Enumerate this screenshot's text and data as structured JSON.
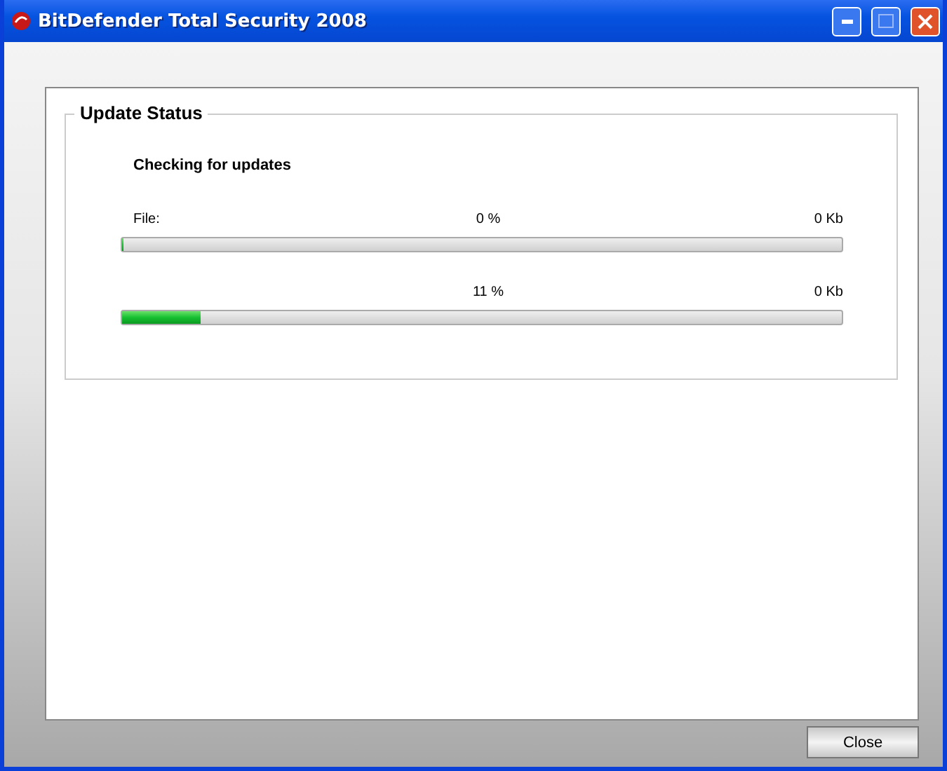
{
  "window": {
    "title": "BitDefender Total Security 2008"
  },
  "update_status": {
    "title": "Update Status",
    "message": "Checking for updates",
    "progress": [
      {
        "label": "File:",
        "percent": "0 %",
        "size": "0 Kb",
        "level": 0
      },
      {
        "percent": "11 %",
        "size": "0 Kb",
        "level": 0.11
      }
    ]
  },
  "buttons": [
    {
      "label": "Close"
    }
  ]
}
